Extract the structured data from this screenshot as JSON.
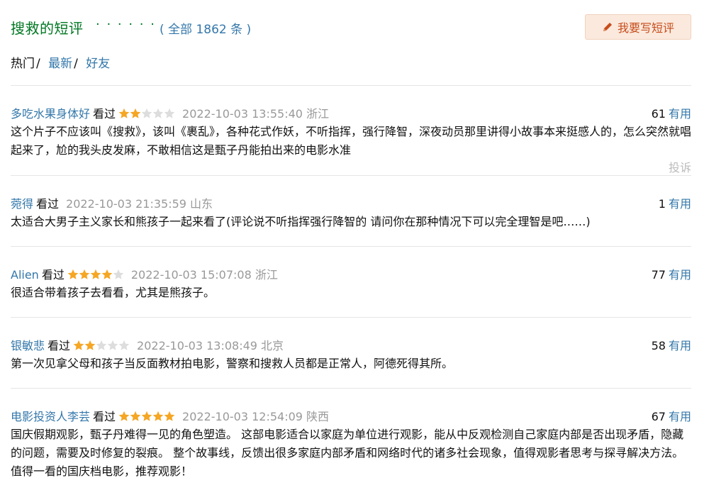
{
  "header": {
    "title": "搜救的短评",
    "dots": "· · · · · ·",
    "total": "( 全部 1862 条 )",
    "write_button": "我要写短评"
  },
  "tabs": [
    {
      "label": "热门",
      "sep": "/"
    },
    {
      "label": "最新",
      "sep": "/"
    },
    {
      "label": "好友",
      "sep": ""
    }
  ],
  "colors": {
    "brand_green": "#007722",
    "link_blue": "#3377aa",
    "star": "#f5a623",
    "star_empty": "#dddddd"
  },
  "comments": [
    {
      "user": "多吃水果身体好",
      "status": "看过",
      "rating": 2,
      "time": "2022-10-03 13:55:40 浙江",
      "votes": "61",
      "useful_label": "有用",
      "text": "这个片子不应该叫《搜救》，该叫《裹乱》，各种花式作妖，不听指挥，强行降智，深夜动员那里讲得小故事本来挺感人的，怎么突然就唱起来了，尬的我头皮发麻，不敢相信这是甄子丹能拍出来的电影水准",
      "report": "投诉"
    },
    {
      "user": "菀得",
      "status": "看过",
      "rating": 0,
      "time": "2022-10-03 21:35:59 山东",
      "votes": "1",
      "useful_label": "有用",
      "text": "太适合大男子主义家长和熊孩子一起来看了(评论说不听指挥强行降智的 请问你在那种情况下可以完全理智是吧……)"
    },
    {
      "user": "Alien",
      "status": "看过",
      "rating": 4,
      "time": "2022-10-03 15:07:08 浙江",
      "votes": "77",
      "useful_label": "有用",
      "text": "很适合带着孩子去看看，尤其是熊孩子。"
    },
    {
      "user": "银敏悲",
      "status": "看过",
      "rating": 2,
      "time": "2022-10-03 13:08:49 北京",
      "votes": "58",
      "useful_label": "有用",
      "text": "第一次见拿父母和孩子当反面教材拍电影，警察和搜救人员都是正常人，阿德死得其所。"
    },
    {
      "user": "电影投资人李芸",
      "status": "看过",
      "rating": 5,
      "time": "2022-10-03 12:54:09 陕西",
      "votes": "67",
      "useful_label": "有用",
      "text": "国庆假期观影，甄子丹难得一见的角色塑造。 这部电影适合以家庭为单位进行观影，能从中反观检测自己家庭内部是否出现矛盾，隐藏的问题，需要及时修复的裂痕。 整个故事线，反馈出很多家庭内部矛盾和网络时代的诸多社会现象，值得观影者思考与探寻解决方法。 值得一看的国庆档电影，推荐观影！"
    }
  ]
}
